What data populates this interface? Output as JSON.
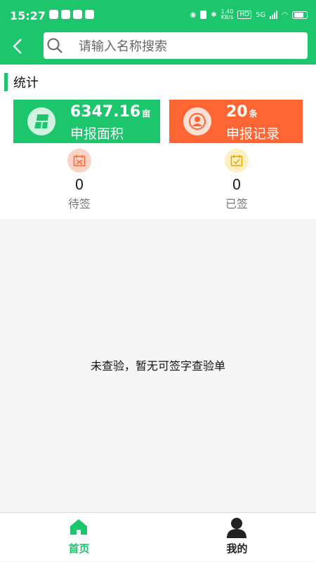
{
  "status_bar": {
    "time": "15:27",
    "net_speed_value": "1.40",
    "net_speed_unit": "KB/s",
    "hd": "HD",
    "signal": "5G"
  },
  "header": {
    "search_placeholder": "请输入名称搜索"
  },
  "stats": {
    "section_title": "统计",
    "area": {
      "value": "6347.16",
      "unit": "亩",
      "label": "申报面积"
    },
    "records": {
      "value": "20",
      "unit": "条",
      "label": "申报记录"
    },
    "pending": {
      "count": "0",
      "label": "待签"
    },
    "signed": {
      "count": "0",
      "label": "已签"
    }
  },
  "empty_message": "未查验，暂无可签字查验单",
  "nav": {
    "home_label": "首页",
    "mine_label": "我的"
  },
  "colors": {
    "brand_green": "#1dc56d",
    "orange": "#ff6633",
    "pending_bg": "#fcd3c4",
    "signed_bg": "#fdf0c3"
  },
  "icons": [
    "back-arrow-icon",
    "search-icon",
    "land-area-icon",
    "record-user-icon",
    "pending-calendar-icon",
    "signed-calendar-icon",
    "home-icon",
    "user-icon"
  ]
}
